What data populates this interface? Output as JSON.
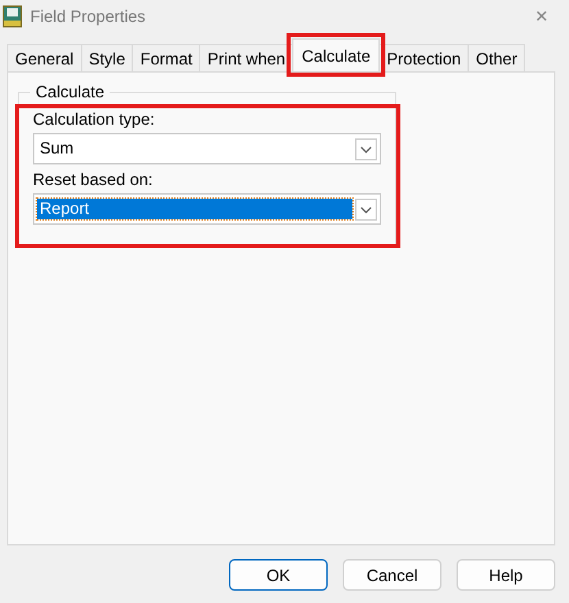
{
  "window": {
    "title": "Field Properties",
    "close": "✕"
  },
  "tabs": [
    {
      "label": "General",
      "selected": false,
      "highlighted": false
    },
    {
      "label": "Style",
      "selected": false,
      "highlighted": false
    },
    {
      "label": "Format",
      "selected": false,
      "highlighted": false
    },
    {
      "label": "Print when",
      "selected": false,
      "highlighted": false
    },
    {
      "label": "Calculate",
      "selected": true,
      "highlighted": true
    },
    {
      "label": "Protection",
      "selected": false,
      "highlighted": false
    },
    {
      "label": "Other",
      "selected": false,
      "highlighted": false
    }
  ],
  "group": {
    "title": "Calculate",
    "highlighted": true,
    "fields": [
      {
        "label": "Calculation type:",
        "value": "Sum",
        "focused": false
      },
      {
        "label": "Reset based on:",
        "value": "Report",
        "focused": true
      }
    ]
  },
  "buttons": [
    {
      "label": "OK",
      "default": true
    },
    {
      "label": "Cancel",
      "default": false
    },
    {
      "label": "Help",
      "default": false
    }
  ]
}
